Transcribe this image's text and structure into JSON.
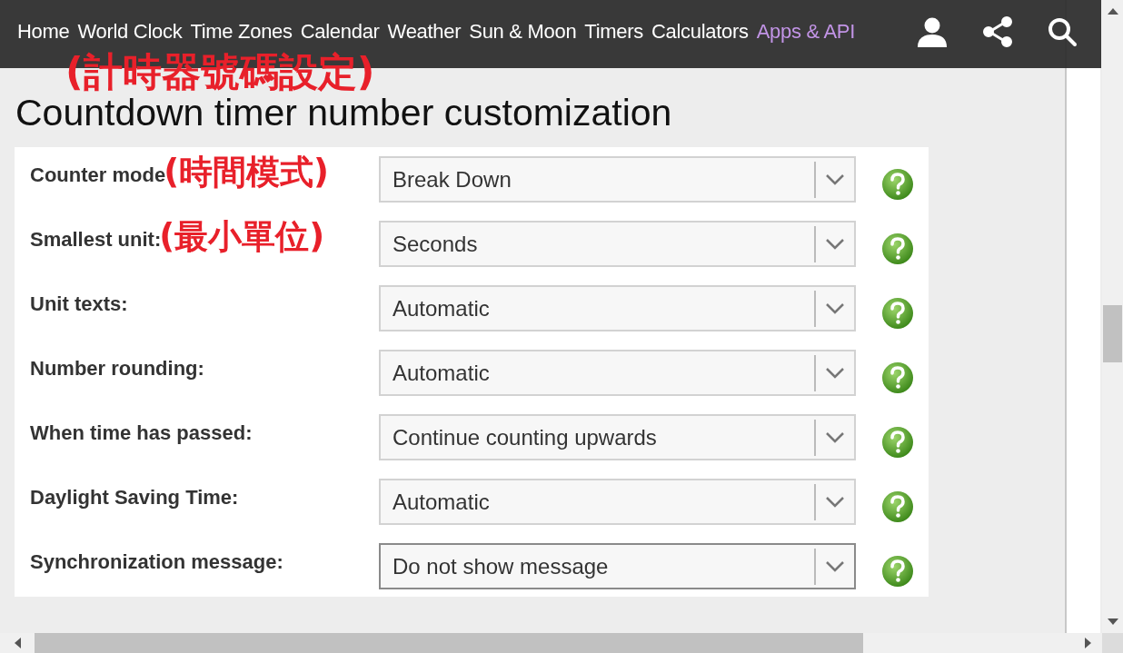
{
  "nav": {
    "items": [
      {
        "label": "Home",
        "selected": false
      },
      {
        "label": "World Clock",
        "selected": false
      },
      {
        "label": "Time Zones",
        "selected": false
      },
      {
        "label": "Calendar",
        "selected": false
      },
      {
        "label": "Weather",
        "selected": false
      },
      {
        "label": "Sun & Moon",
        "selected": false
      },
      {
        "label": "Timers",
        "selected": false
      },
      {
        "label": "Calculators",
        "selected": false
      },
      {
        "label": "Apps & API",
        "selected": true
      }
    ]
  },
  "heading_note": "(計時器號碼設定)",
  "heading": "Countdown timer number customization",
  "settings": [
    {
      "label": "Counter mode",
      "value": "Break Down",
      "focused": false,
      "note": "(時間模式)"
    },
    {
      "label": "Smallest unit:",
      "value": "Seconds",
      "focused": false,
      "note": "(最小單位)"
    },
    {
      "label": "Unit texts:",
      "value": "Automatic",
      "focused": false
    },
    {
      "label": "Number rounding:",
      "value": "Automatic",
      "focused": false
    },
    {
      "label": "When time has passed:",
      "value": "Continue counting upwards",
      "focused": false
    },
    {
      "label": "Daylight Saving Time:",
      "value": "Automatic",
      "focused": false
    },
    {
      "label": "Synchronization message:",
      "value": "Do not show message",
      "focused": true
    }
  ]
}
